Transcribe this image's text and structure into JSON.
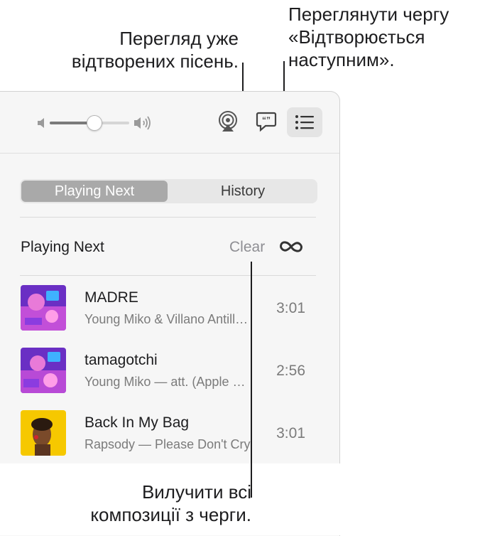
{
  "callouts": {
    "queue": [
      "Переглянути чергу",
      "«Відтворюється",
      "наступним»."
    ],
    "history": [
      "Перегляд уже",
      "відтворених пісень."
    ],
    "clear": [
      "Вилучити всі",
      "композиції з черги."
    ]
  },
  "toolbar": {
    "volume_level": 0.55,
    "icons": [
      "volume-low-icon",
      "volume-high-icon",
      "airplay-icon",
      "lyrics-icon",
      "queue-list-icon"
    ]
  },
  "tabs": [
    {
      "label": "Playing Next",
      "active": true
    },
    {
      "label": "History",
      "active": false
    }
  ],
  "queue": {
    "heading": "Playing Next",
    "clear_label": "Clear",
    "autoplay_icon": "infinity-icon",
    "songs": [
      {
        "title": "MADRE",
        "subtitle": "Young Miko & Villano Antillano",
        "duration": "3:01",
        "art": "purple-pink"
      },
      {
        "title": "tamagotchi",
        "subtitle": "Young Miko — att. (Apple Music Edition)",
        "duration": "2:56",
        "art": "purple-pink"
      },
      {
        "title": "Back In My Bag",
        "subtitle": "Rapsody — Please Don't Cry",
        "duration": "3:01",
        "art": "yellow-portrait"
      }
    ]
  },
  "colors": {
    "active_tab": "#a9a9a9",
    "window_bg": "#f6f6f6",
    "art_purple": "#7b3fd1",
    "art_pink": "#e85fd0",
    "art_yellow": "#f6c800"
  }
}
